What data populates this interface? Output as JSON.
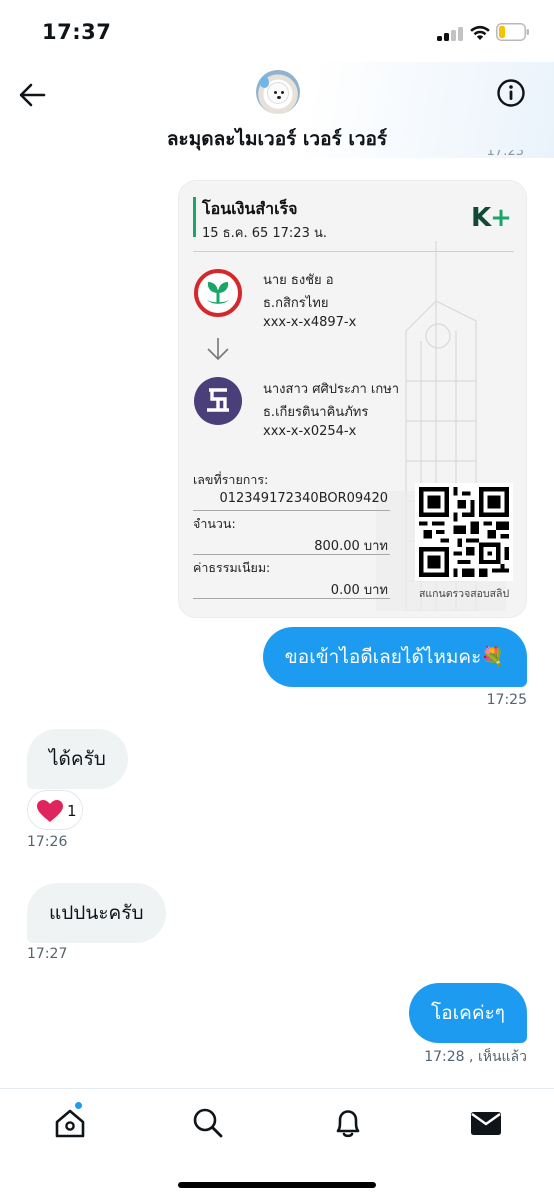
{
  "status_bar": {
    "time": "17:37",
    "battery_level": 0.25,
    "battery_color": "#f5c400"
  },
  "header": {
    "chat_title": "ละมุดละไมเวอร์ เวอร์ เวอร์",
    "back_icon": "arrow-left-icon",
    "info_icon": "info-circle-icon"
  },
  "slip": {
    "title": "โอนเงินสำเร็จ",
    "date": "15 ธ.ค. 65  17:23 น.",
    "brand": "K",
    "brand_plus": "+",
    "sender": {
      "name": "นาย ธงชัย อ",
      "bank": "ธ.กสิกรไทย",
      "account": "xxx-x-x4897-x"
    },
    "receiver": {
      "name": "นางสาว ศศิประภา เกษา",
      "bank": "ธ.เกียรตินาคินภัทร",
      "account": "xxx-x-x0254-x"
    },
    "ref_label": "เลขที่รายการ:",
    "ref_value": "012349172340BOR09420",
    "amount_label": "จำนวน:",
    "amount_value": "800.00 บาท",
    "fee_label": "ค่าธรรมเนียม:",
    "fee_value": "0.00 บาท",
    "qr_caption": "สแกนตรวจสอบสลิป",
    "colors": {
      "kbank_red": "#d4282c",
      "kbank_green": "#1aa66a",
      "kkp_purple": "#4a3f78"
    }
  },
  "messages": [
    {
      "direction": "out",
      "text": "ขอเข้าไอดีเลยได้ไหมคะ💐",
      "time": "17:25"
    },
    {
      "direction": "in",
      "text": "ได้ครับ",
      "reaction": "heart",
      "reaction_count": "1",
      "time": "17:26"
    },
    {
      "direction": "in",
      "text": "แปปนะครับ",
      "time": "17:27"
    },
    {
      "direction": "out",
      "text": "โอเคค่ะๆ",
      "time": "17:28",
      "status": ", เห็นแล้ว"
    }
  ],
  "tabbar": {
    "items": [
      {
        "name": "home",
        "icon": "home-icon",
        "active_dot": true
      },
      {
        "name": "search",
        "icon": "search-icon"
      },
      {
        "name": "notifications",
        "icon": "bell-icon"
      },
      {
        "name": "messages",
        "icon": "envelope-icon"
      }
    ]
  },
  "colors": {
    "accent": "#1d9bf0",
    "incoming_bubble": "#eff3f4",
    "meta_text": "#536471"
  }
}
